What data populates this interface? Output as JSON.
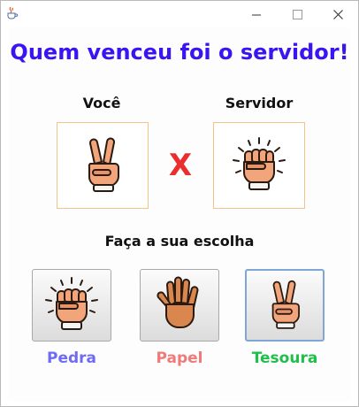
{
  "window": {
    "title": "",
    "app_icon": "java-coffee-icon",
    "controls": [
      "minimize-icon",
      "maximize-icon",
      "close-icon"
    ]
  },
  "result": {
    "headline": "Quem venceu foi o servidor!",
    "headline_color": "#3a14f2"
  },
  "match": {
    "you_label": "Você",
    "server_label": "Servidor",
    "versus": "X",
    "versus_color": "#ec2d2d",
    "you_hand": "scissors-hand-icon",
    "server_hand": "rock-fist-icon"
  },
  "prompt": "Faça a sua escolha",
  "choices": [
    {
      "label": "Pedra",
      "icon": "rock-fist-icon",
      "color": "#6f6bf2"
    },
    {
      "label": "Papel",
      "icon": "paper-open-hand-icon",
      "color": "#f07a7a"
    },
    {
      "label": "Tesoura",
      "icon": "scissors-hand-icon",
      "color": "#1fbf4a",
      "focused": true
    }
  ]
}
